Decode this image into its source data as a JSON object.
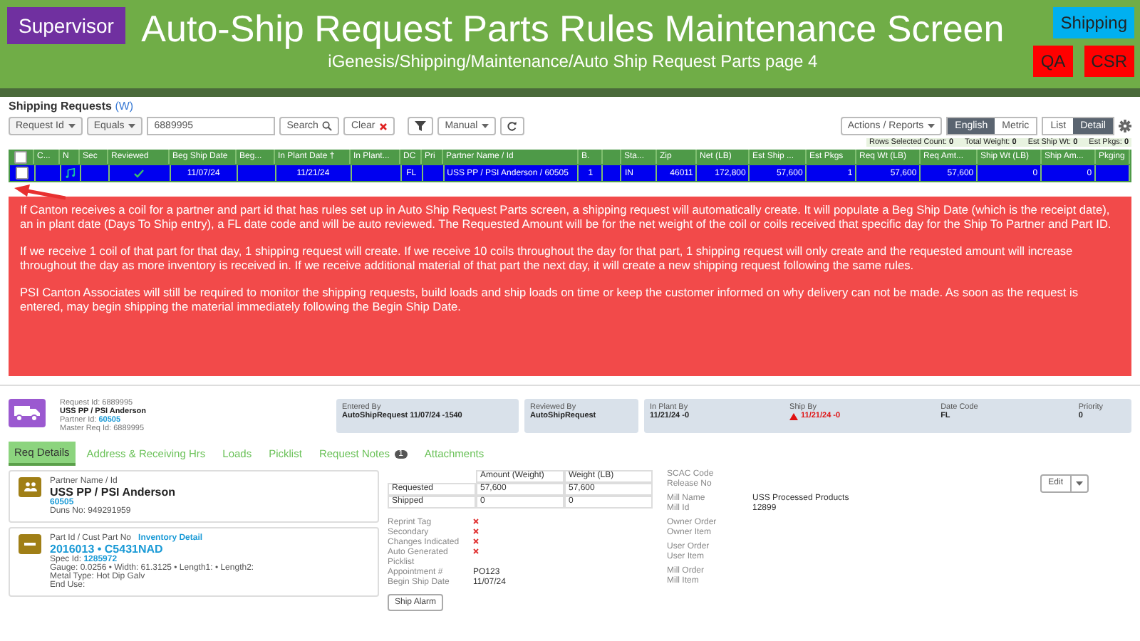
{
  "header": {
    "role": "Supervisor",
    "title": "Auto-Ship Request Parts Rules Maintenance Screen",
    "subtitle": "iGenesis/Shipping/Maintenance/Auto Ship Request Parts page 4",
    "badges": [
      {
        "label": "Shipping",
        "color": "#00b0f0"
      },
      {
        "label": "QA",
        "color": "#ff0000"
      },
      {
        "label": "CSR",
        "color": "#ff0000"
      }
    ]
  },
  "section": {
    "title": "Shipping Requests",
    "link": "(W)"
  },
  "toolbar": {
    "field_select": "Request Id",
    "operator_select": "Equals",
    "search_value": "6889995",
    "search_button": "Search",
    "clear_button": "Clear",
    "mode_select": "Manual",
    "actions_button": "Actions / Reports",
    "units": [
      {
        "label": "English",
        "selected": true
      },
      {
        "label": "Metric",
        "selected": false
      }
    ],
    "views": [
      {
        "label": "List",
        "selected": false
      },
      {
        "label": "Detail",
        "selected": true
      }
    ]
  },
  "stats": [
    {
      "label": "Rows Selected Count:",
      "value": "0"
    },
    {
      "label": "Total Weight:",
      "value": "0"
    },
    {
      "label": "Est Ship Wt:",
      "value": "0"
    },
    {
      "label": "Est Pkgs:",
      "value": "0"
    }
  ],
  "table": {
    "select_all_checked": false,
    "columns": [
      "C...",
      "N",
      "Sec",
      "Reviewed",
      "Beg Ship Date",
      "Beg...",
      "In Plant Date †",
      "In Plant...",
      "DC",
      "Pri",
      "Partner Name / Id",
      "B.",
      "",
      "Sta...",
      "Zip",
      "Net (LB)",
      "Est Ship ...",
      "Est Pkgs",
      "Req Wt (LB)",
      "Req Amt...",
      "Ship Wt (LB)",
      "Ship Am...",
      "Pkging"
    ],
    "rows": [
      {
        "selected": true,
        "checked": false,
        "reviewed": true,
        "cells": [
          "",
          "",
          "",
          "",
          "11/07/24",
          "",
          "11/21/24",
          "",
          "FL",
          "",
          "USS PP / PSI Anderson / 60505",
          "1",
          "",
          "IN",
          "46011",
          "172,800",
          "57,600",
          "1",
          "57,600",
          "57,600",
          "0",
          "0",
          ""
        ]
      }
    ]
  },
  "callout": {
    "paragraphs": [
      "If Canton receives a coil for a partner and part id that has rules set up in Auto Ship Request Parts screen, a shipping request will automatically create. It will populate a Beg Ship Date (which is the receipt date), an in plant date (Days To Ship entry), a FL date code and will be auto reviewed. The Requested Amount will be for the net weight of the coil or coils received that specific day for the Ship To Partner and Part ID.",
      "If we receive 1 coil of that part for that day, 1 shipping request will create. If we receive 10 coils throughout the day for that part, 1 shipping request will only create and the requested amount will increase throughout the day as more inventory is received in. If we receive additional material of that part the next day, it will create a new shipping request following the same rules.",
      "PSI Canton Associates will still be required to monitor the shipping requests, build loads and ship loads on time or keep the customer informed on why delivery can not be made. As soon as the request is entered, may begin shipping the material immediately following the Begin Ship Date."
    ]
  },
  "detail": {
    "request_id": "Request Id: 6889995",
    "partner": "USS PP / PSI Anderson",
    "partner_id_label": "Partner Id:",
    "partner_id": "60505",
    "master_req_id": "Master Req Id: 6889995",
    "entered_by": {
      "label": "Entered By",
      "value": "AutoShipRequest 11/07/24 -1540"
    },
    "reviewed_by": {
      "label": "Reviewed By",
      "value": "AutoShipRequest"
    },
    "dates": [
      {
        "label": "In Plant By",
        "value": "11/21/24 -0",
        "warning": false
      },
      {
        "label": "Ship By",
        "value": "11/21/24 -0",
        "warning": true
      },
      {
        "label": "Date Code",
        "value": "FL",
        "warning": false
      },
      {
        "label": "Priority",
        "value": "0",
        "warning": false
      }
    ],
    "tabs": [
      {
        "label": "Req Details",
        "selected": true
      },
      {
        "label": "Address & Receiving Hrs",
        "selected": false
      },
      {
        "label": "Loads",
        "selected": false
      },
      {
        "label": "Picklist",
        "selected": false
      },
      {
        "label": "Request Notes",
        "selected": false,
        "badge": "1"
      },
      {
        "label": "Attachments",
        "selected": false
      }
    ],
    "partner_card": {
      "label": "Partner Name / Id",
      "name": "USS PP / PSI Anderson",
      "id": "60505",
      "duns": "Duns No: 949291959"
    },
    "part_card": {
      "label": "Part Id / Cust Part No",
      "link": "Inventory Detail",
      "part": "2016013 • C5431NAD",
      "spec_label": "Spec Id:",
      "spec": "1285972",
      "lines": [
        "Gauge: 0.0256 • Width: 61.3125 • Length1: • Length2:",
        "Metal Type: Hot Dip Galv",
        "End Use:"
      ]
    },
    "amounts": {
      "columns": [
        "",
        "Amount (Weight)",
        "Weight (LB)"
      ],
      "rows": [
        [
          "Requested",
          "57,600",
          "57,600"
        ],
        [
          "Shipped",
          "0",
          "0"
        ]
      ]
    },
    "flags": [
      {
        "label": "Reprint Tag",
        "kind": "flag",
        "on": false
      },
      {
        "label": "Secondary",
        "kind": "flag",
        "on": false
      },
      {
        "label": "Changes Indicated",
        "kind": "flag",
        "on": false
      },
      {
        "label": "Auto Generated Picklist",
        "kind": "flag",
        "on": false
      },
      {
        "label": "Appointment #",
        "kind": "text",
        "value": "PO123"
      },
      {
        "label": "Begin Ship Date",
        "kind": "text",
        "value": "11/07/24"
      }
    ],
    "alarm_button": "Ship Alarm",
    "info_groups": [
      [
        {
          "label": "SCAC Code"
        },
        {
          "label": "Release No"
        }
      ],
      [
        {
          "label": "Mill Name",
          "value": "USS Processed Products"
        },
        {
          "label": "Mill Id",
          "value": "12899"
        }
      ],
      [
        {
          "label": "Owner Order"
        },
        {
          "label": "Owner Item"
        }
      ],
      [
        {
          "label": "User Order"
        },
        {
          "label": "User Item"
        }
      ],
      [
        {
          "label": "Mill Order"
        },
        {
          "label": "Mill Item"
        }
      ]
    ],
    "edit_button": "Edit"
  }
}
